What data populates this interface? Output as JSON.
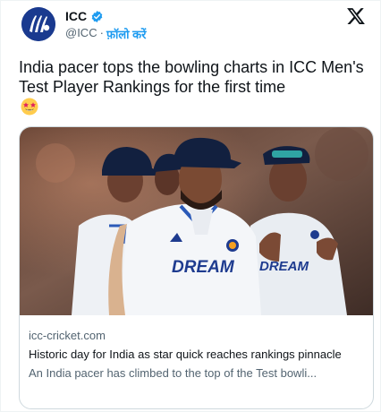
{
  "account": {
    "name": "ICC",
    "handle": "@ICC",
    "separator": "·",
    "follow_label": "फ़ॉलो करें",
    "verified": true,
    "verified_color": "#1d9bf0",
    "avatar_color": "#1a3a8f"
  },
  "platform_icon": "x-logo-icon",
  "tweet": {
    "text": "India pacer tops the bowling charts in ICC Men's Test Player Rankings for the first time",
    "emoji": "star-struck-emoji"
  },
  "card": {
    "image_description_icon": "cricket-photo",
    "domain": "icc-cricket.com",
    "title": "Historic day for India as star quick reaches rankings pinnacle",
    "description": "An India pacer has climbed to the top of the Test bowli...",
    "jersey_text": "DREAM11"
  },
  "colors": {
    "link": "#1d9bf0",
    "secondary_text": "#536471",
    "primary_text": "#0f1419",
    "border": "#cfd9de"
  }
}
